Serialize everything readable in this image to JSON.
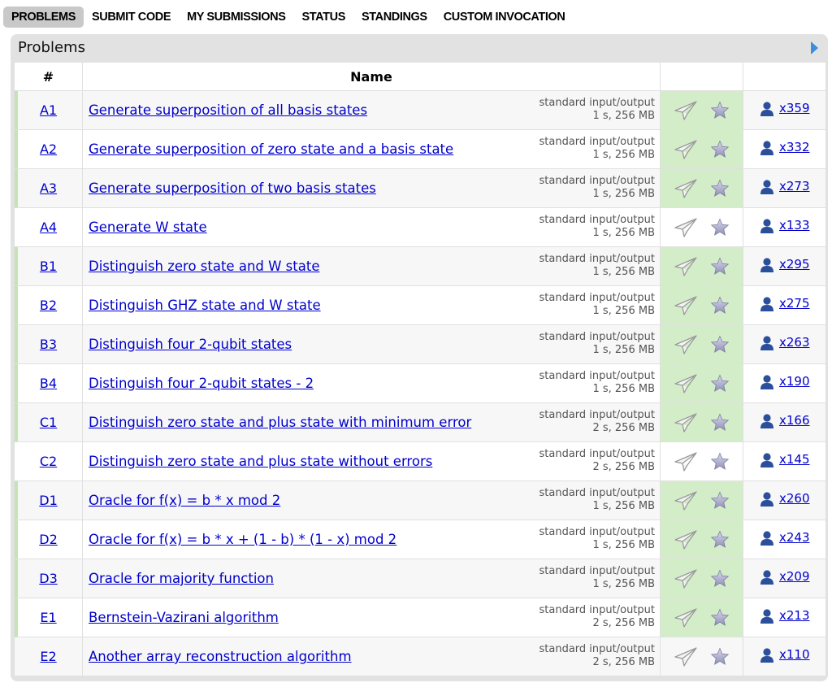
{
  "nav": [
    "PROBLEMS",
    "SUBMIT CODE",
    "MY SUBMISSIONS",
    "STATUS",
    "STANDINGS",
    "CUSTOM INVOCATION"
  ],
  "panel_title": "Problems",
  "table_headers": {
    "index": "#",
    "name": "Name"
  },
  "accepted_color": "#d4edc9",
  "problems": [
    {
      "index": "A1",
      "name": "Generate superposition of all basis states",
      "io": "standard input/output",
      "limits": "1 s, 256 MB",
      "solved": "x359",
      "accepted": true
    },
    {
      "index": "A2",
      "name": "Generate superposition of zero state and a basis state",
      "io": "standard input/output",
      "limits": "1 s, 256 MB",
      "solved": "x332",
      "accepted": true
    },
    {
      "index": "A3",
      "name": "Generate superposition of two basis states",
      "io": "standard input/output",
      "limits": "1 s, 256 MB",
      "solved": "x273",
      "accepted": true
    },
    {
      "index": "A4",
      "name": "Generate W state",
      "io": "standard input/output",
      "limits": "1 s, 256 MB",
      "solved": "x133",
      "accepted": false
    },
    {
      "index": "B1",
      "name": "Distinguish zero state and W state",
      "io": "standard input/output",
      "limits": "1 s, 256 MB",
      "solved": "x295",
      "accepted": true
    },
    {
      "index": "B2",
      "name": "Distinguish GHZ state and W state",
      "io": "standard input/output",
      "limits": "1 s, 256 MB",
      "solved": "x275",
      "accepted": true
    },
    {
      "index": "B3",
      "name": "Distinguish four 2-qubit states",
      "io": "standard input/output",
      "limits": "1 s, 256 MB",
      "solved": "x263",
      "accepted": true
    },
    {
      "index": "B4",
      "name": "Distinguish four 2-qubit states - 2",
      "io": "standard input/output",
      "limits": "1 s, 256 MB",
      "solved": "x190",
      "accepted": true
    },
    {
      "index": "C1",
      "name": "Distinguish zero state and plus state with minimum error",
      "io": "standard input/output",
      "limits": "2 s, 256 MB",
      "solved": "x166",
      "accepted": true
    },
    {
      "index": "C2",
      "name": "Distinguish zero state and plus state without errors",
      "io": "standard input/output",
      "limits": "2 s, 256 MB",
      "solved": "x145",
      "accepted": false
    },
    {
      "index": "D1",
      "name": "Oracle for f(x) = b * x mod 2",
      "io": "standard input/output",
      "limits": "1 s, 256 MB",
      "solved": "x260",
      "accepted": true
    },
    {
      "index": "D2",
      "name": "Oracle for f(x) = b * x + (1 - b) * (1 - x) mod 2",
      "io": "standard input/output",
      "limits": "1 s, 256 MB",
      "solved": "x243",
      "accepted": true
    },
    {
      "index": "D3",
      "name": "Oracle for majority function",
      "io": "standard input/output",
      "limits": "1 s, 256 MB",
      "solved": "x209",
      "accepted": true
    },
    {
      "index": "E1",
      "name": "Bernstein-Vazirani algorithm",
      "io": "standard input/output",
      "limits": "2 s, 256 MB",
      "solved": "x213",
      "accepted": true
    },
    {
      "index": "E2",
      "name": "Another array reconstruction algorithm",
      "io": "standard input/output",
      "limits": "2 s, 256 MB",
      "solved": "x110",
      "accepted": false
    }
  ]
}
